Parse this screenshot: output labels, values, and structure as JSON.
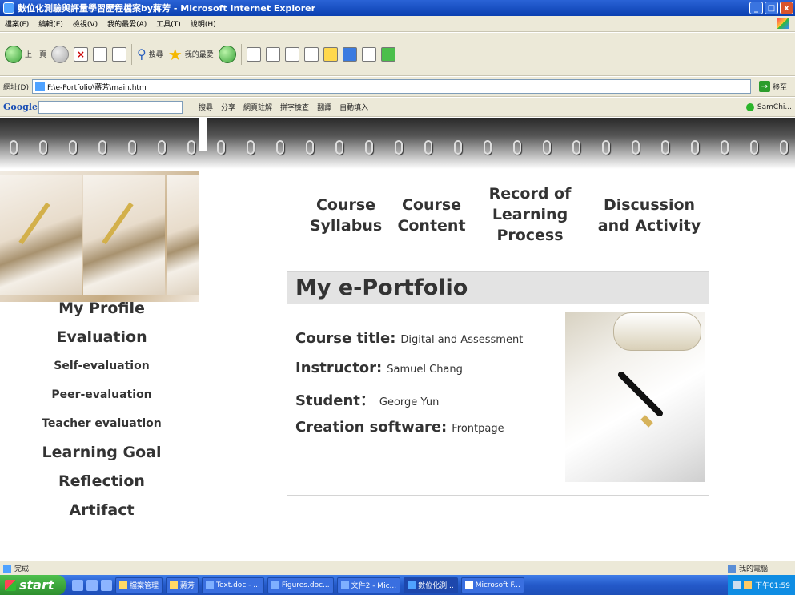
{
  "window": {
    "title": "數位化測驗與評量學習歷程檔案by蔣芳 - Microsoft Internet Explorer",
    "min": "_",
    "max": "□",
    "close": "x"
  },
  "menu": [
    "檔案(F)",
    "編輯(E)",
    "檢視(V)",
    "我的最愛(A)",
    "工具(T)",
    "說明(H)"
  ],
  "toolbar": {
    "back_label": "上一頁",
    "search_label": "搜尋",
    "favorites_label": "我的最愛"
  },
  "address": {
    "label": "網址(D)",
    "url": "F:\\e-Portfolio\\蔣芳\\main.htm",
    "go_label": "移至"
  },
  "googlebar": {
    "logo": "Google",
    "search_label": "搜尋",
    "share_label": "分享",
    "annotate_label": "網頁註解",
    "spell_label": "拼字檢查",
    "translate_label": "翻譯",
    "autofill_label": "自動填入",
    "user": "SamChi..."
  },
  "topnav": {
    "syllabus": "Course\nSyllabus",
    "content": "Course\nContent",
    "record": "Record of\nLearning\nProcess",
    "discussion": "Discussion\nand Activity"
  },
  "leftnav": {
    "profile": "My Profile",
    "evaluation": "Evaluation",
    "self_eval": "Self-evaluation",
    "peer_eval": "Peer-evaluation",
    "teacher_eval": "Teacher evaluation",
    "goal": "Learning Goal",
    "reflection": "Reflection",
    "artifact": "Artifact"
  },
  "portfolio": {
    "heading": "My e-Portfolio",
    "course_label": "Course title:",
    "course_value": "Digital and Assessment",
    "instructor_label": "Instructor:",
    "instructor_value": "Samuel Chang",
    "student_label": "Student：",
    "student_value": "George Yun",
    "software_label": "Creation software:",
    "software_value": "Frontpage"
  },
  "statusbar": {
    "status": "完成",
    "zone": "我的電腦"
  },
  "taskbar": {
    "start": "start",
    "tasks": [
      "檔案管理",
      "蔣芳",
      "Text.doc - ...",
      "Figures.doc...",
      "文件2 - Mic...",
      "數位化測...",
      "Microsoft F..."
    ],
    "clock": "下午01:59"
  },
  "colors": {
    "panel_header_bg": "#e3e3e3",
    "nav_text": "#333333",
    "taskbar": "#2459c9",
    "start_button": "#3aa33a"
  }
}
